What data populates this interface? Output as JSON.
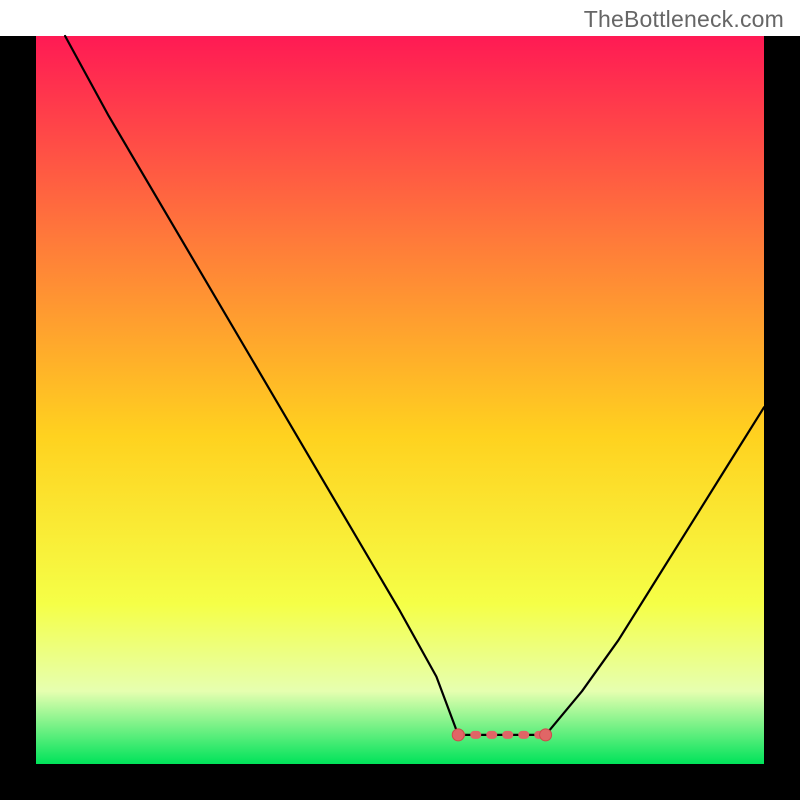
{
  "watermark": "TheBottleneck.com",
  "chart_data": {
    "type": "line",
    "title": "",
    "xlabel": "",
    "ylabel": "",
    "xlim": [
      0,
      100
    ],
    "ylim": [
      0,
      100
    ],
    "optimal_range": {
      "x_start": 58,
      "x_end": 70
    },
    "series": [
      {
        "name": "bottleneck-curve",
        "x": [
          4,
          10,
          20,
          30,
          40,
          50,
          55,
          58,
          64,
          70,
          75,
          80,
          85,
          90,
          95,
          100
        ],
        "y": [
          100,
          89,
          72,
          55,
          38,
          21,
          12,
          4,
          4,
          4,
          10,
          17,
          25,
          33,
          41,
          49
        ]
      }
    ],
    "markers": [
      {
        "name": "optimal-start",
        "x": 58,
        "y": 4
      },
      {
        "name": "optimal-end",
        "x": 70,
        "y": 4
      }
    ]
  },
  "colors": {
    "gradient_top": "#ff1a54",
    "gradient_mid_upper": "#ff7a3a",
    "gradient_mid": "#ffd21f",
    "gradient_mid_lower": "#f5ff47",
    "gradient_low": "#e6ffb0",
    "gradient_bottom": "#00e35a",
    "frame": "#000000",
    "curve": "#000000",
    "marker_fill": "#e06666",
    "marker_stroke": "#cc4b4b"
  }
}
